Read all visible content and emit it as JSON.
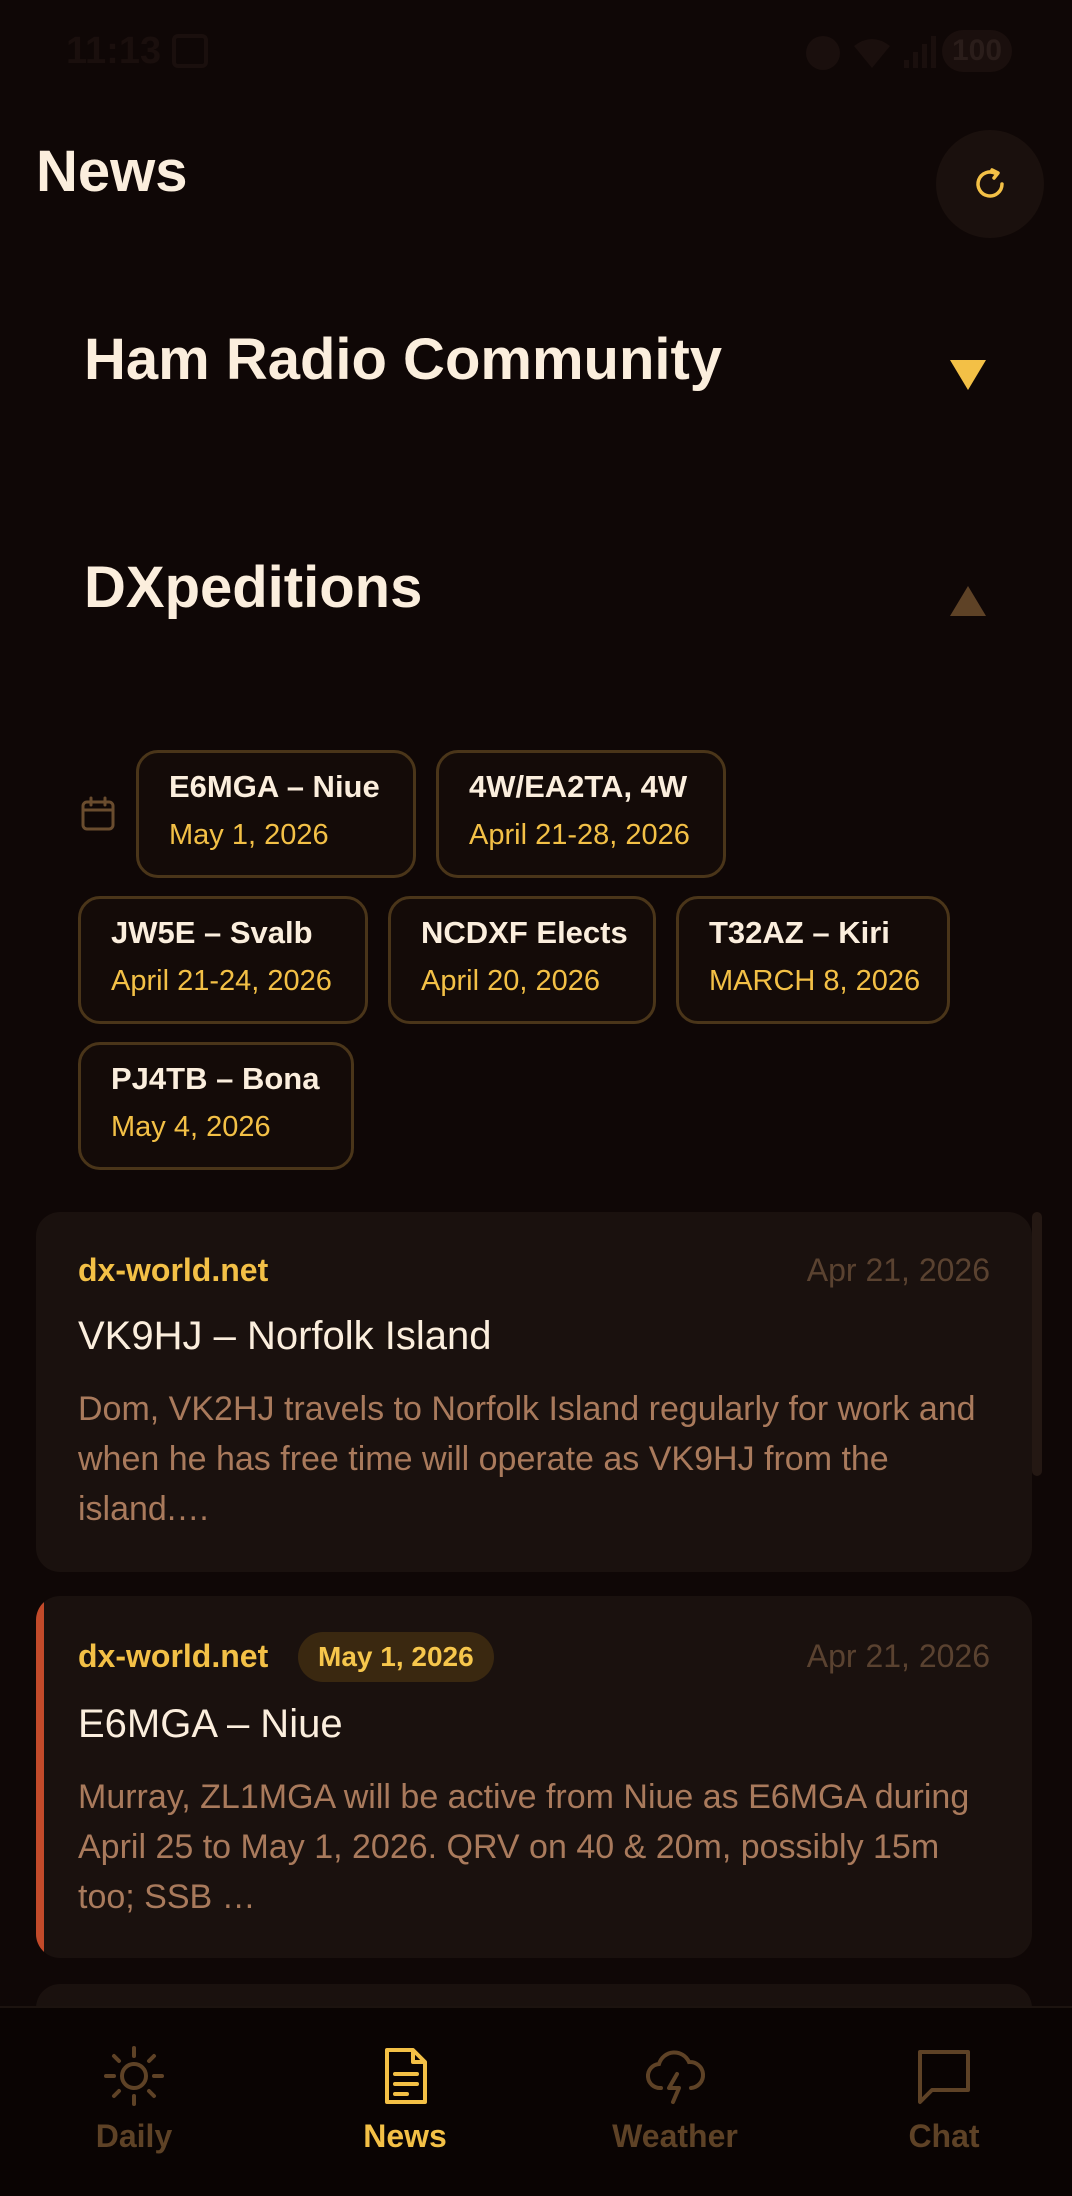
{
  "status_bar": {
    "time": "11:13",
    "battery": "100"
  },
  "header": {
    "title": "News"
  },
  "sections": {
    "community": {
      "title": "Ham Radio Community"
    },
    "dxpeditions": {
      "title": "DXpeditions"
    }
  },
  "chips": [
    {
      "title": "E6MGA – Niue",
      "date": "May 1, 2026"
    },
    {
      "title": "4W/EA2TA, 4W",
      "date": "April 21-28, 2026"
    },
    {
      "title": "JW5E – Svalb",
      "date": "April 21-24, 2026"
    },
    {
      "title": "NCDXF Elects",
      "date": "April 20, 2026"
    },
    {
      "title": "T32AZ – Kiri",
      "date": "MARCH 8, 2026"
    },
    {
      "title": "PJ4TB – Bona",
      "date": "May 4, 2026"
    }
  ],
  "cards": [
    {
      "source": "dx-world.net",
      "time": "Apr 21, 2026",
      "title": "VK9HJ – Norfolk Island",
      "body": "Dom, VK2HJ travels to Norfolk Island regularly for work and when he has free time will operate as VK9HJ from the island.…"
    },
    {
      "source": "dx-world.net",
      "badge": "May 1, 2026",
      "time": "Apr 21, 2026",
      "title": "E6MGA – Niue",
      "body": "Murray, ZL1MGA will be active from Niue as E6MGA during April 25 to May 1, 2026. QRV on 40 & 20m, possibly 15m too; SSB …"
    }
  ],
  "nav": {
    "daily": "Daily",
    "news": "News",
    "weather": "Weather",
    "chat": "Chat"
  },
  "colors": {
    "accent": "#f3c046",
    "background": "#0f0706",
    "highlight_bar": "#c24a2a",
    "muted_text": "#a97a5c"
  }
}
